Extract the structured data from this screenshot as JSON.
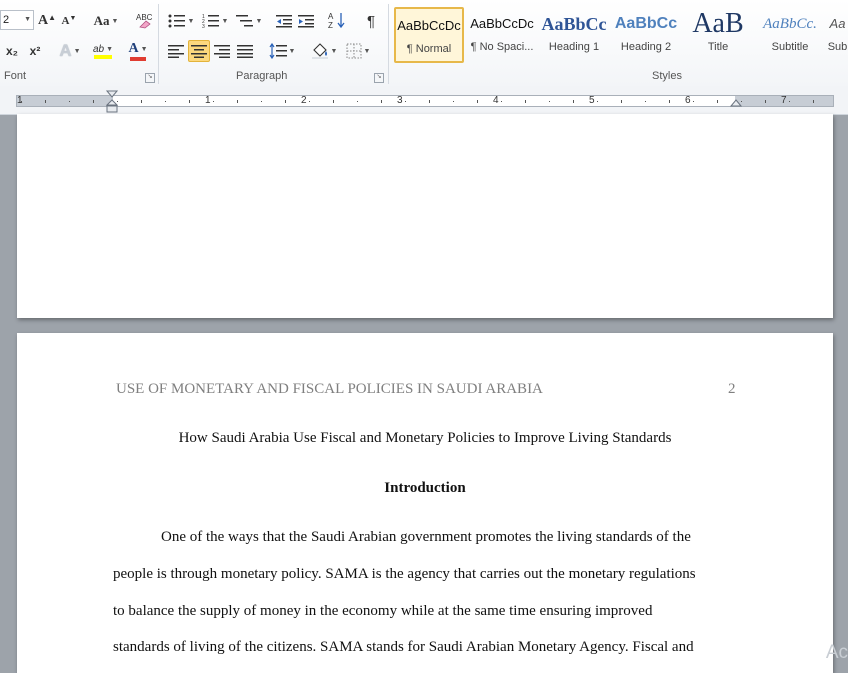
{
  "ribbon": {
    "font_group": {
      "label": "Font",
      "font_size": "2",
      "buttons": {
        "grow": "A",
        "shrink": "A",
        "change_case": "Aa",
        "clear_format": "ABC",
        "subscript": "x₂",
        "superscript": "x²",
        "text_effects": "A",
        "highlight": "ab",
        "font_color": "A"
      }
    },
    "paragraph_group": {
      "label": "Paragraph"
    },
    "styles_group": {
      "label": "Styles",
      "tiles": [
        {
          "sample": "AaBbCcDc",
          "name": "¶ Normal"
        },
        {
          "sample": "AaBbCcDc",
          "name": "¶ No Spaci..."
        },
        {
          "sample": "AaBbCc",
          "name": "Heading 1"
        },
        {
          "sample": "AaBbCc",
          "name": "Heading 2"
        },
        {
          "sample": "AaB",
          "name": "Title"
        },
        {
          "sample": "AaBbCc.",
          "name": "Subtitle"
        },
        {
          "sample": "Aa",
          "name": "Sub"
        }
      ]
    },
    "colors": {
      "highlight": "#ffff00",
      "font_color": "#e03c31",
      "active": "#fcd87e"
    }
  },
  "ruler": {
    "numbers": [
      "1",
      "1",
      "2",
      "3",
      "4",
      "5",
      "6",
      "7"
    ]
  },
  "document": {
    "running_head": "USE OF MONETARY AND FISCAL POLICIES IN SAUDI ARABIA",
    "page_number": "2",
    "title": "How Saudi Arabia Use Fiscal and Monetary Policies to Improve Living Standards",
    "heading": "Introduction",
    "body_lines": [
      "One of the ways that the Saudi Arabian government promotes the living standards of the",
      "people is through monetary policy. SAMA is the agency that carries out the monetary regulations",
      "to balance the supply of money in the economy while at the same time ensuring improved",
      "standards of living of the citizens. SAMA stands for Saudi Arabian Monetary Agency. Fiscal and"
    ]
  },
  "watermark": "Ac"
}
